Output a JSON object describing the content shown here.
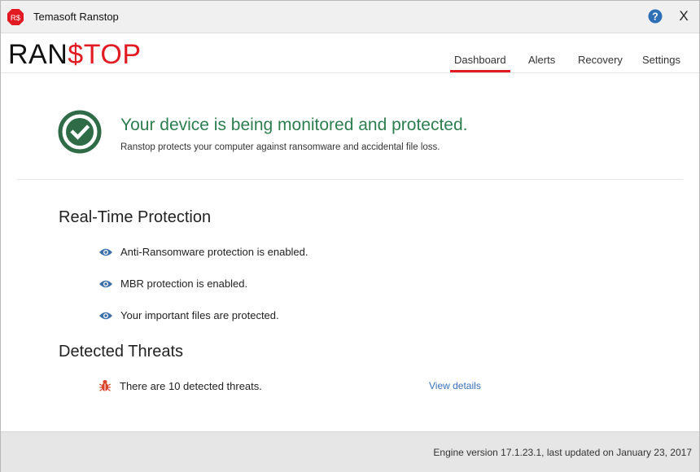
{
  "window": {
    "title": "Temasoft Ranstop",
    "app_icon_text": "R$",
    "close_label": "X",
    "help_icon": "question-circle-icon"
  },
  "header": {
    "logo_part1": "RAN",
    "logo_part2": "$",
    "logo_part3": "TOP",
    "tabs": [
      {
        "label": "Dashboard",
        "active": true
      },
      {
        "label": "Alerts",
        "active": false
      },
      {
        "label": "Recovery",
        "active": false
      },
      {
        "label": "Settings",
        "active": false
      }
    ]
  },
  "status": {
    "icon": "check-circle-icon",
    "title": "Your device is being monitored and protected.",
    "subtitle": "Ranstop protects your computer against ransomware and accidental file loss."
  },
  "realtime": {
    "heading": "Real-Time Protection",
    "items": [
      {
        "icon": "eye-icon",
        "text": "Anti-Ransomware protection is enabled."
      },
      {
        "icon": "eye-icon",
        "text": "MBR protection is enabled."
      },
      {
        "icon": "eye-icon",
        "text": "Your important files are protected."
      }
    ]
  },
  "threats": {
    "heading": "Detected Threats",
    "icon": "bug-icon",
    "text": "There are 10 detected threats.",
    "link": "View details"
  },
  "footer": {
    "engine_text": "Engine version 17.1.23.1, last updated on January 23, 2017"
  },
  "colors": {
    "brand_red": "#e21b23",
    "success_green": "#2e7d4f",
    "link_blue": "#3b6fb6",
    "eye_blue": "#3d6fa8",
    "bug_red": "#d9452c"
  }
}
